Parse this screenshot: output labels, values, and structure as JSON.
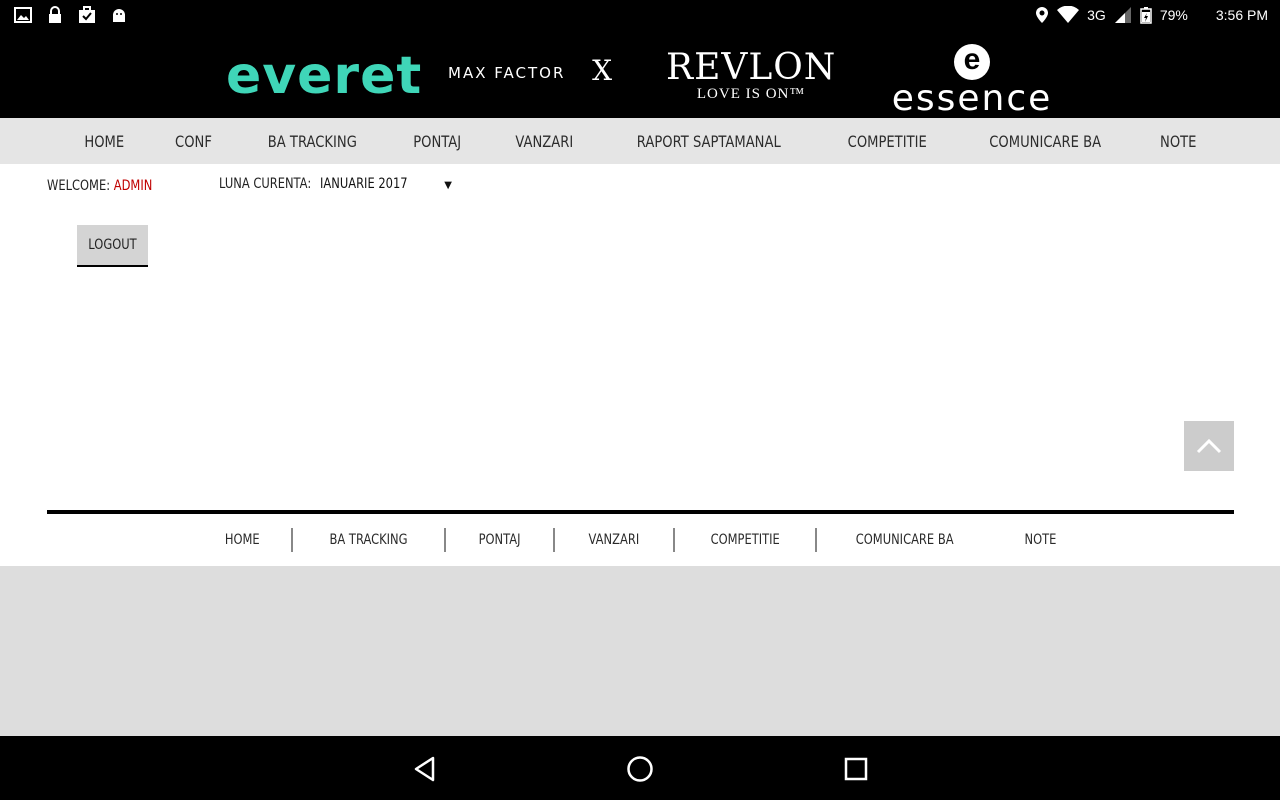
{
  "status_bar": {
    "left_icons": [
      "image-icon",
      "lock-icon",
      "briefcase-check-icon",
      "android-icon"
    ],
    "battery": "79%",
    "time": "3:56 PM",
    "network": "3G"
  },
  "brands": {
    "everet": "everet",
    "maxfactor": "MAX FACTOR",
    "maxfactor_x": "X",
    "revlon": "REVLON",
    "revlon_tagline": "LOVE IS ON™",
    "essence_mark": "e",
    "essence": "essence"
  },
  "main_nav": {
    "items": [
      "HOME",
      "CONF",
      "BA TRACKING",
      "PONTAJ",
      "VANZARI",
      "RAPORT SAPTAMANAL",
      "COMPETITIE",
      "COMUNICARE BA",
      "NOTE"
    ]
  },
  "user_bar": {
    "welcome_label": "WELCOME:",
    "username": "ADMIN",
    "month_label": "LUNA CURENTA:",
    "month_value": "IANUARIE 2017",
    "logout_label": "LOGOUT"
  },
  "footer_nav": {
    "items": [
      "HOME",
      "BA TRACKING",
      "PONTAJ",
      "VANZARI",
      "COMPETITIE",
      "COMUNICARE BA",
      "NOTE"
    ]
  },
  "colors": {
    "accent_everet": "#3fd6b8",
    "username": "#c00000",
    "nav_bg": "#e5e5e5"
  }
}
